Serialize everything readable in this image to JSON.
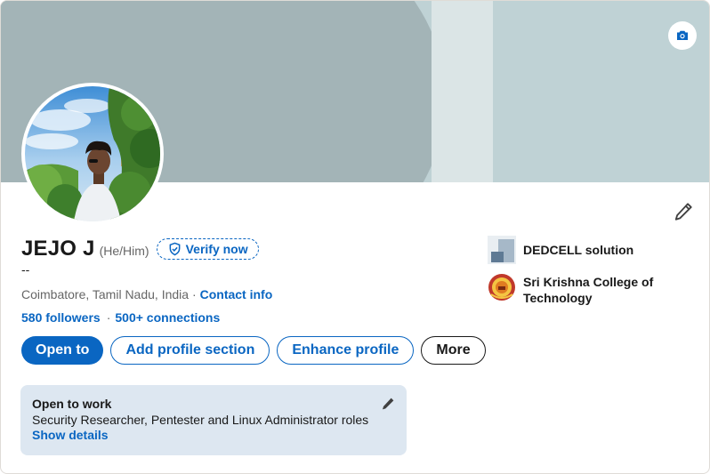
{
  "profile": {
    "name": "JEJO J",
    "pronouns": "(He/Him)",
    "verify_label": "Verify now",
    "headline": "--",
    "location": "Coimbatore, Tamil Nadu, India ·",
    "contact_info_label": "Contact info",
    "followers_label": "580 followers",
    "connections_separator": "·",
    "connections_label": "500+ connections"
  },
  "actions": {
    "open_to_label": "Open to",
    "add_section_label": "Add profile section",
    "enhance_label": "Enhance profile",
    "more_label": "More"
  },
  "organizations": [
    {
      "name": "DEDCELL solution",
      "icon": "company-logo"
    },
    {
      "name": "Sri Krishna College of Technology",
      "icon": "school-logo"
    }
  ],
  "open_to_work": {
    "title": "Open to work",
    "roles": "Security Researcher, Pentester and Linux Administrator roles",
    "link_label": "Show details"
  },
  "icons": {
    "camera": "camera-icon",
    "edit": "pencil-icon",
    "verify": "shield-check-icon"
  },
  "colors": {
    "accent": "#0a66c2",
    "banner_light": "#bfd2d5",
    "banner_dark": "#a3b4b7",
    "open_to_work_bg": "#dde7f1"
  }
}
